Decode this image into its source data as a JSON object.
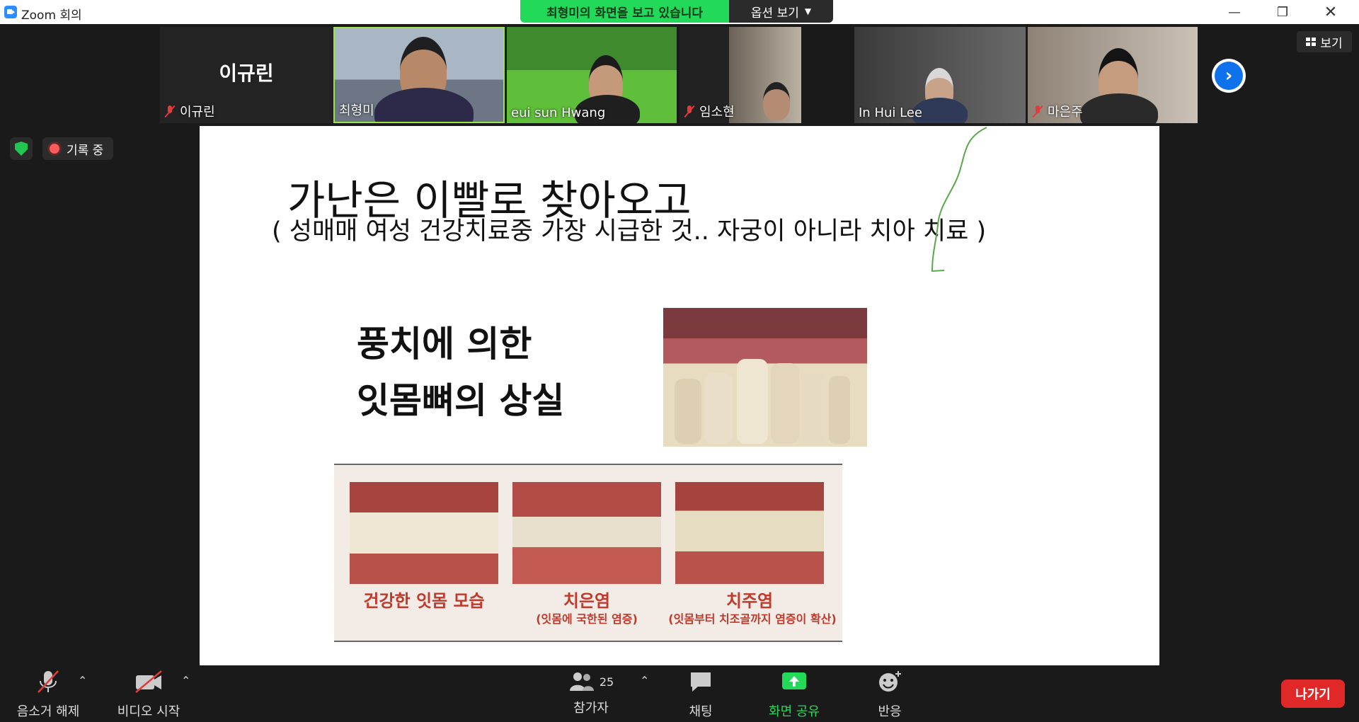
{
  "window": {
    "title": "Zoom 회의"
  },
  "share_banner": {
    "message": "최형미의 화면을 보고 있습니다",
    "options": "옵션 보기"
  },
  "participants": [
    {
      "name": "이규린",
      "display_name": "이규린",
      "muted": true
    },
    {
      "name": "최형미",
      "muted": false
    },
    {
      "name": "eui sun Hwang",
      "muted": false
    },
    {
      "name": "임소현",
      "muted": true
    },
    {
      "name": "In Hui Lee",
      "muted": false
    },
    {
      "name": "마은주",
      "muted": true
    }
  ],
  "view": {
    "label": "보기"
  },
  "recording": {
    "label": "기록 중"
  },
  "slide": {
    "title": "가난은 이빨로 찾아오고",
    "subtitle": "( 성매매 여성 건강치료중 가장 시급한 것.. 자궁이 아니라 치아 치료 )",
    "caption_line1": "풍치에 의한",
    "caption_line2": "잇몸뼈의 상실",
    "panels": [
      {
        "label": "건강한 잇몸 모습",
        "sub": ""
      },
      {
        "label": "치은염",
        "sub": "(잇몸에 국한된 염증)"
      },
      {
        "label": "치주염",
        "sub": "(잇몸부터 치조골까지 염증이 확산)"
      }
    ]
  },
  "toolbar": {
    "unmute": "음소거 해제",
    "start_video": "비디오 시작",
    "participants": "참가자",
    "participant_count": "25",
    "chat": "채팅",
    "share_screen": "화면 공유",
    "reactions": "반응",
    "leave": "나가기"
  },
  "colors": {
    "accent_green": "#23d959",
    "leave_red": "#e02828",
    "zoom_blue": "#0e72ed"
  }
}
